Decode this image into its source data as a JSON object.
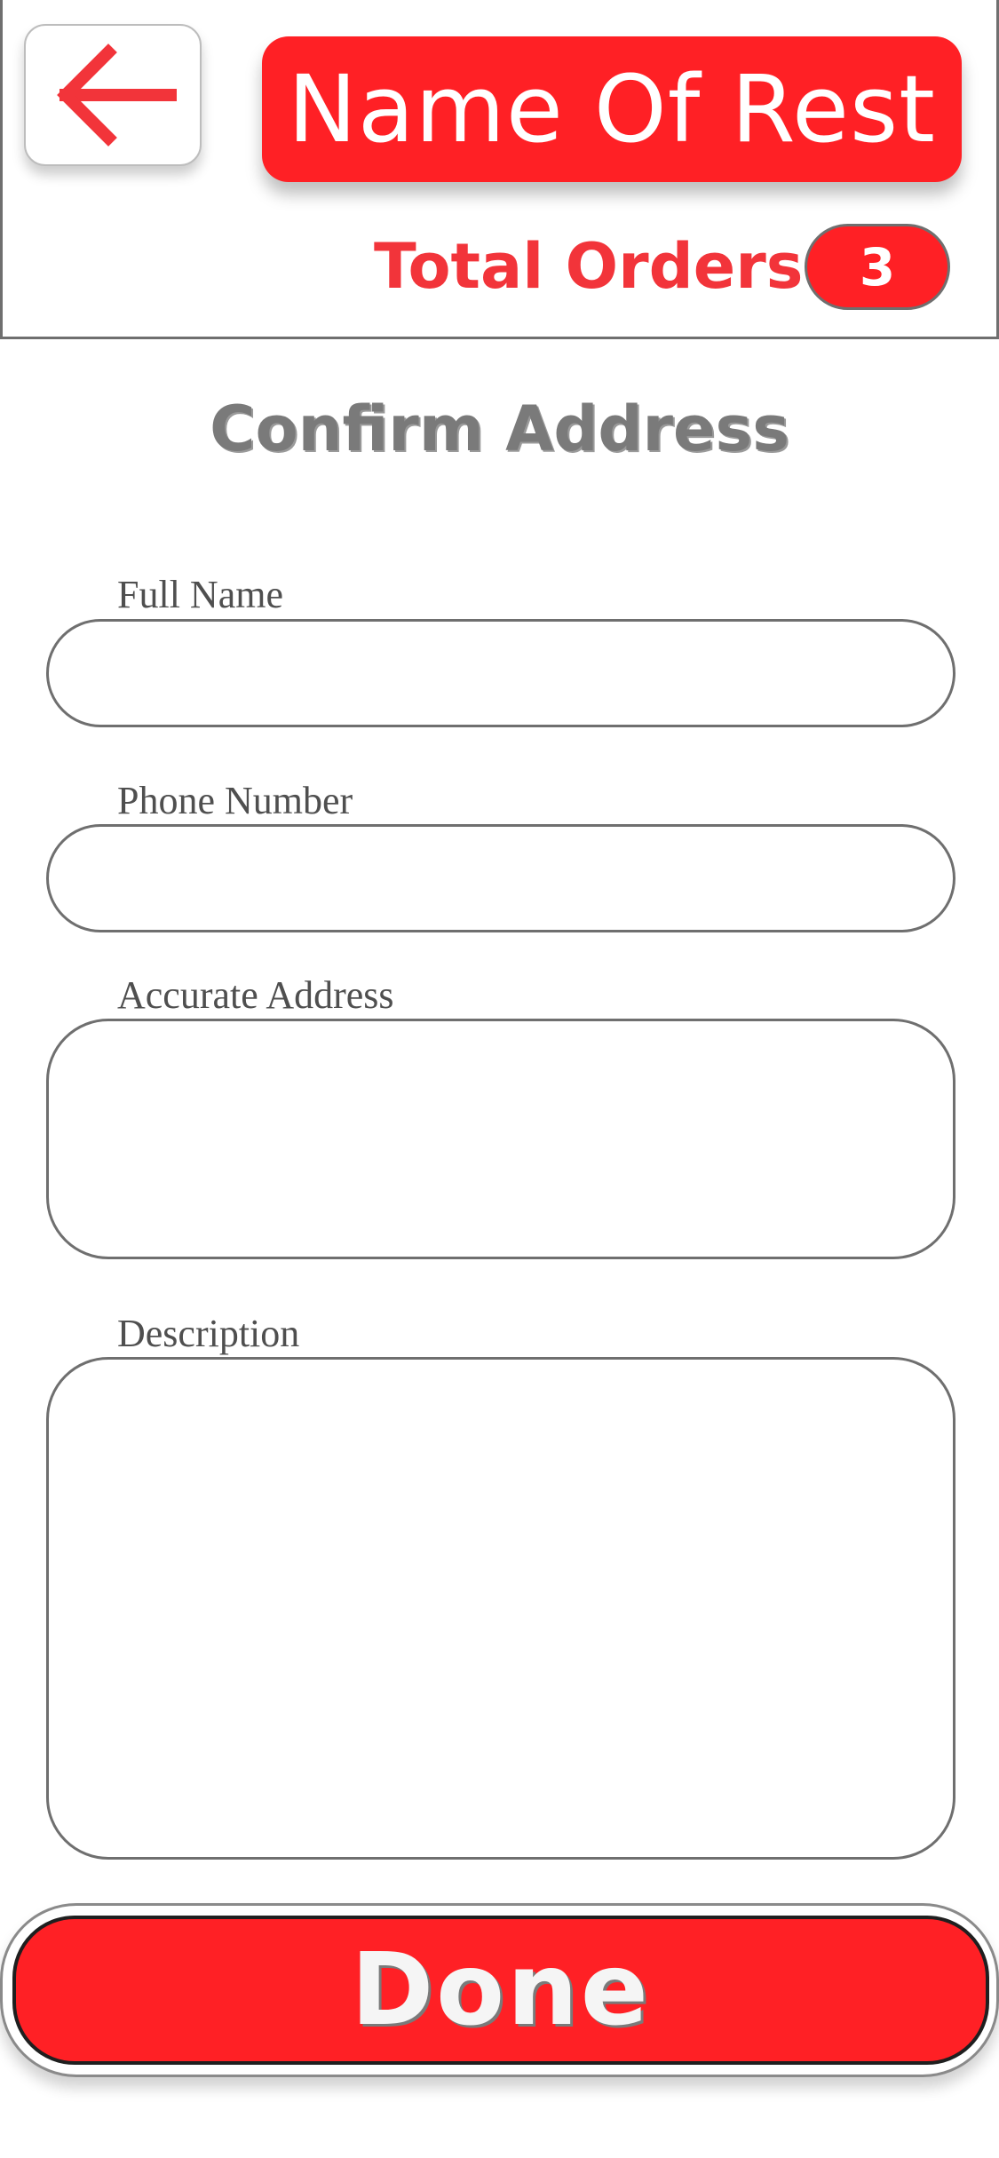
{
  "header": {
    "back_icon": "arrow-left-icon",
    "restaurant_name": "Name Of Rest",
    "total_orders_label": "Total Orders:",
    "total_orders_count": "3"
  },
  "page": {
    "title": "Confirm Address"
  },
  "form": {
    "full_name": {
      "label": "Full Name",
      "value": "",
      "placeholder": ""
    },
    "phone_number": {
      "label": "Phone Number",
      "value": "",
      "placeholder": ""
    },
    "accurate_address": {
      "label": "Accurate Address",
      "value": "",
      "placeholder": ""
    },
    "description": {
      "label": "Description",
      "value": "",
      "placeholder": ""
    }
  },
  "actions": {
    "done_label": "Done"
  },
  "colors": {
    "accent": "#ff2025",
    "accent_text": "#f2343a",
    "title_gray": "#7a7a7a",
    "border_gray": "#6f6f6f"
  }
}
